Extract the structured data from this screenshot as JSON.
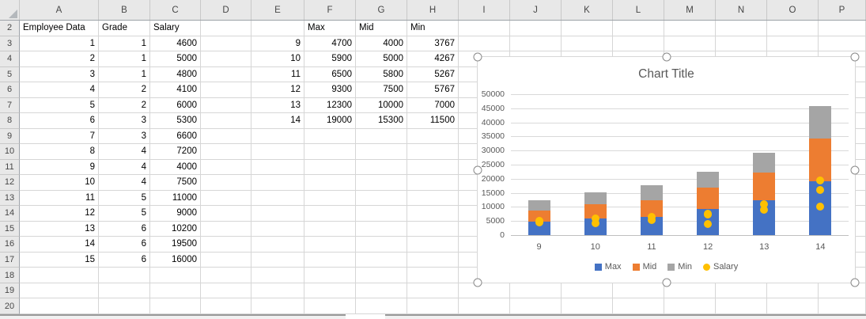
{
  "sheet": {
    "column_headers": [
      "A",
      "B",
      "C",
      "D",
      "E",
      "F",
      "G",
      "H",
      "I",
      "J",
      "K",
      "L",
      "M",
      "N",
      "O",
      "P"
    ],
    "row_headers": [
      2,
      3,
      4,
      5,
      6,
      7,
      8,
      9,
      10,
      11,
      12,
      13,
      14,
      15,
      16,
      17,
      18,
      19,
      20
    ],
    "employee_table": {
      "title_header": "Employee Data",
      "grade_header": "Grade",
      "salary_header": "Salary",
      "rows": [
        [
          1,
          1,
          4600
        ],
        [
          2,
          1,
          5000
        ],
        [
          3,
          1,
          4800
        ],
        [
          4,
          2,
          4100
        ],
        [
          5,
          2,
          6000
        ],
        [
          6,
          3,
          5300
        ],
        [
          7,
          3,
          6600
        ],
        [
          8,
          4,
          7200
        ],
        [
          9,
          4,
          4000
        ],
        [
          10,
          4,
          7500
        ],
        [
          11,
          5,
          11000
        ],
        [
          12,
          5,
          9000
        ],
        [
          13,
          6,
          10200
        ],
        [
          14,
          6,
          19500
        ],
        [
          15,
          6,
          16000
        ]
      ]
    },
    "summary_table": {
      "max_header": "Max",
      "mid_header": "Mid",
      "min_header": "Min",
      "rows": [
        [
          9,
          4700,
          4000,
          3767
        ],
        [
          10,
          5900,
          5000,
          4267
        ],
        [
          11,
          6500,
          5800,
          5267
        ],
        [
          12,
          9300,
          7500,
          5767
        ],
        [
          13,
          12300,
          10000,
          7000
        ],
        [
          14,
          19000,
          15300,
          11500
        ]
      ]
    }
  },
  "chart_data": {
    "type": "bar",
    "subtype": "stacked-column-with-scatter-overlay",
    "title": "Chart Title",
    "categories": [
      9,
      10,
      11,
      12,
      13,
      14
    ],
    "stacked": true,
    "series": [
      {
        "name": "Max",
        "render": "bar",
        "color": "#4472C4",
        "values": [
          4700,
          5900,
          6500,
          9300,
          12300,
          19000
        ]
      },
      {
        "name": "Mid",
        "render": "bar",
        "color": "#ED7D31",
        "values": [
          4000,
          5000,
          5800,
          7500,
          10000,
          15300
        ]
      },
      {
        "name": "Min",
        "render": "bar",
        "color": "#A5A5A5",
        "values": [
          3767,
          4267,
          5267,
          5767,
          7000,
          11500
        ]
      },
      {
        "name": "Salary",
        "render": "scatter",
        "color": "#FFC000",
        "points": [
          {
            "x": 9,
            "values": [
              4600,
              5000,
              4800
            ]
          },
          {
            "x": 10,
            "values": [
              4100,
              6000
            ]
          },
          {
            "x": 11,
            "values": [
              5300,
              6600
            ]
          },
          {
            "x": 12,
            "values": [
              7200,
              4000,
              7500
            ]
          },
          {
            "x": 13,
            "values": [
              11000,
              9000
            ]
          },
          {
            "x": 14,
            "values": [
              10200,
              19500,
              16000
            ]
          }
        ]
      }
    ],
    "ylim": [
      0,
      50000
    ],
    "ytick_step": 5000,
    "yticks": [
      0,
      5000,
      10000,
      15000,
      20000,
      25000,
      30000,
      35000,
      40000,
      45000,
      50000
    ],
    "grid": true,
    "legend_position": "bottom",
    "legend": [
      "Max",
      "Mid",
      "Min",
      "Salary"
    ]
  }
}
